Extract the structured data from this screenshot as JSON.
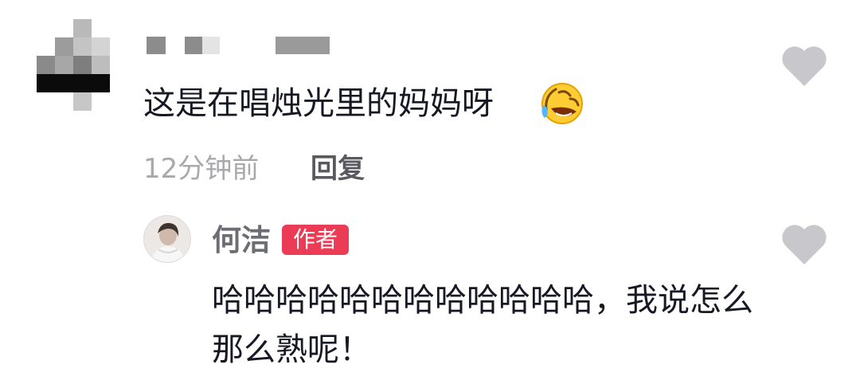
{
  "comment": {
    "username": "",
    "text": "这是在唱烛光里的妈妈呀",
    "emoji_icon": "rolling-on-floor-laughing-emoji",
    "time": "12分钟前",
    "reply_label": "回复",
    "like_icon": "heart-icon"
  },
  "reply": {
    "username": "何洁",
    "badge": "作者",
    "text": "哈哈哈哈哈哈哈哈哈哈哈哈，我说怎么那么熟呢！",
    "like_icon": "heart-icon"
  },
  "colors": {
    "primary_text": "#161823",
    "secondary_text": "#a8a8ad",
    "name_text": "#6d6e73",
    "badge_bg": "#ec3b55",
    "like_gray": "#c8c8cc"
  }
}
